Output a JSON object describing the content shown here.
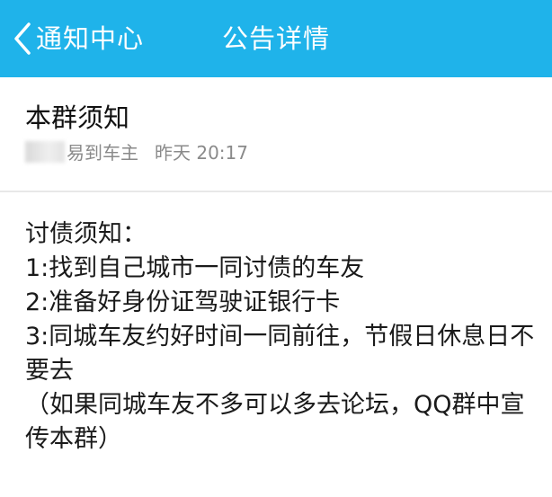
{
  "header": {
    "back_label": "通知中心",
    "title": "公告详情",
    "accent_color": "#1fb3ea"
  },
  "notice": {
    "title": "本群须知",
    "author": "易到车主",
    "time": "昨天 20:17",
    "body": [
      "讨债须知：",
      "1:找到自己城市一同讨债的车友",
      "2:准备好身份证驾驶证银行卡",
      "3:同城车友约好时间一同前往，节假日休息日不要去",
      "（如果同城车友不多可以多去论坛，QQ群中宣传本群）"
    ]
  }
}
